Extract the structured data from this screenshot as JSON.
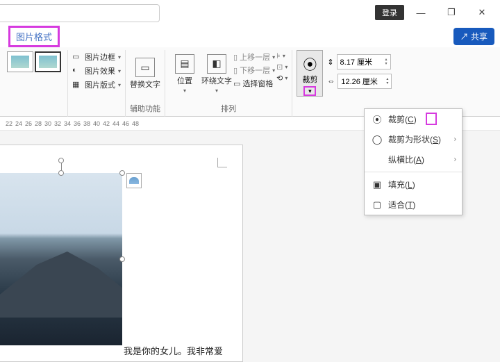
{
  "titlebar": {
    "login": "登录",
    "minimize": "—",
    "maximize": "❐",
    "close": "✕"
  },
  "tabs": {
    "picture_format": "图片格式",
    "share": "共享"
  },
  "ribbon": {
    "pic_border": "图片边框",
    "pic_effect": "图片效果",
    "pic_layout": "图片版式",
    "alt_text": "替换文字",
    "accessibility": "辅助功能",
    "position": "位置",
    "wrap_text": "环绕文字",
    "bring_forward": "上移一层",
    "send_backward": "下移一层",
    "selection_pane": "选择窗格",
    "arrange": "排列",
    "crop": "裁剪",
    "height": "8.17 厘米",
    "width": "12.26 厘米"
  },
  "crop_menu": {
    "crop": "裁剪",
    "crop_key": "C",
    "crop_shape": "裁剪为形状",
    "crop_shape_key": "S",
    "aspect": "纵横比",
    "aspect_key": "A",
    "fill": "填充",
    "fill_key": "L",
    "fit": "适合",
    "fit_key": "T"
  },
  "ruler": [
    "22",
    "24",
    "26",
    "28",
    "30",
    "32",
    "34",
    "36",
    "38",
    "40",
    "42",
    "44",
    "46",
    "48"
  ],
  "document": {
    "text": "我是你的女儿。我非常爱"
  }
}
